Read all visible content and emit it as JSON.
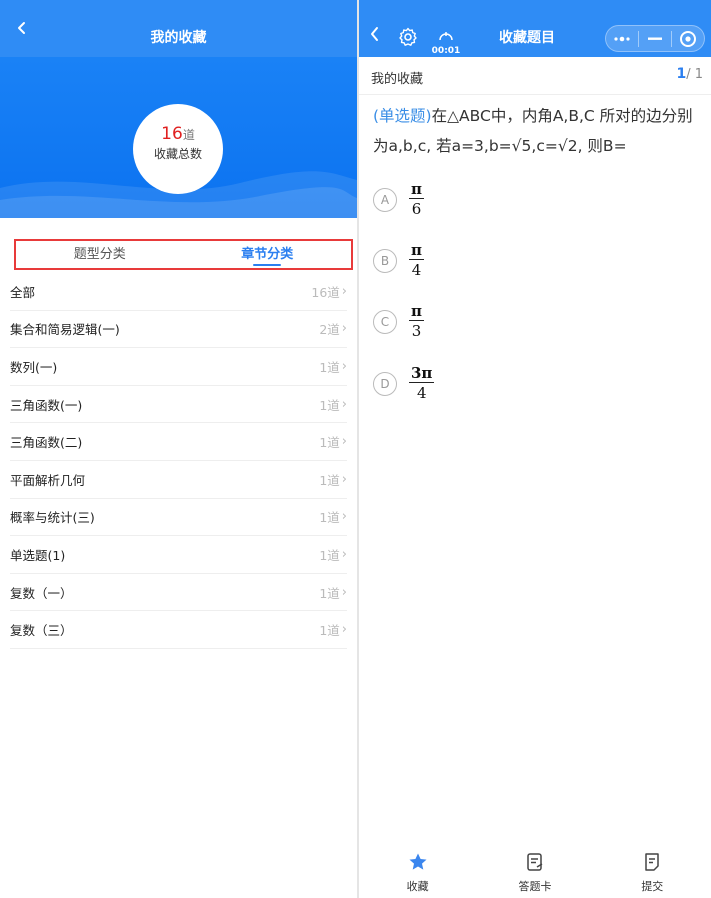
{
  "left": {
    "title": "我的收藏",
    "summary": {
      "count": "16",
      "unit": "道",
      "label": "收藏总数"
    },
    "tabs": [
      {
        "label": "题型分类",
        "active": false
      },
      {
        "label": "章节分类",
        "active": true
      }
    ],
    "items": [
      {
        "name": "全部",
        "count": "16道"
      },
      {
        "name": "集合和简易逻辑(一)",
        "count": "2道"
      },
      {
        "name": "数列(一)",
        "count": "1道"
      },
      {
        "name": "三角函数(一)",
        "count": "1道"
      },
      {
        "name": "三角函数(二)",
        "count": "1道"
      },
      {
        "name": "平面解析几何",
        "count": "1道"
      },
      {
        "name": "概率与统计(三)",
        "count": "1道"
      },
      {
        "name": "单选题(1)",
        "count": "1道"
      },
      {
        "name": "复数（一）",
        "count": "1道"
      },
      {
        "name": "复数（三）",
        "count": "1道"
      }
    ],
    "chevron": "›"
  },
  "right": {
    "title": "收藏题目",
    "timer": "00:01",
    "subbar": {
      "name": "我的收藏",
      "current": "1",
      "total": "/ 1"
    },
    "question": {
      "type": "(单选题)",
      "text": "在△ABC中，内角A,B,C 所对的边分别为a,b,c, 若a=3,b=√5,c=√2, 则B="
    },
    "options": [
      {
        "letter": "A",
        "num": "π",
        "den": "6"
      },
      {
        "letter": "B",
        "num": "π",
        "den": "4"
      },
      {
        "letter": "C",
        "num": "π",
        "den": "3"
      },
      {
        "letter": "D",
        "num": "3π",
        "den": "4"
      }
    ],
    "bottom": [
      {
        "label": "收藏",
        "icon": "star-icon"
      },
      {
        "label": "答题卡",
        "icon": "answer-card-icon"
      },
      {
        "label": "提交",
        "icon": "submit-icon"
      }
    ]
  },
  "colors": {
    "nav": "#2f8cf5",
    "accent": "#2b7ff0",
    "count": "#e02020",
    "highlight": "#e83a3a"
  }
}
